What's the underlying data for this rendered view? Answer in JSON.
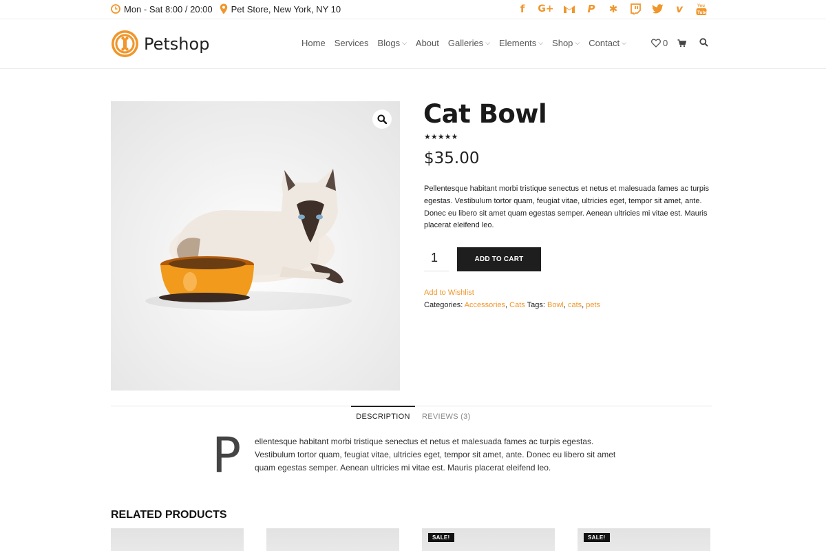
{
  "topbar": {
    "hours": "Mon - Sat 8:00 / 20:00",
    "location": "Pet Store, New York, NY 10",
    "social": [
      "facebook-icon",
      "google-plus-icon",
      "gmail-icon",
      "paypal-icon",
      "slack-icon",
      "twitch-icon",
      "twitter-icon",
      "vimeo-icon",
      "youtube-icon"
    ]
  },
  "header": {
    "brand": "Petshop",
    "nav": [
      {
        "label": "Home",
        "dropdown": false
      },
      {
        "label": "Services",
        "dropdown": false
      },
      {
        "label": "Blogs",
        "dropdown": true
      },
      {
        "label": "About",
        "dropdown": false
      },
      {
        "label": "Galleries",
        "dropdown": true
      },
      {
        "label": "Elements",
        "dropdown": true
      },
      {
        "label": "Shop",
        "dropdown": true
      },
      {
        "label": "Contact",
        "dropdown": true
      }
    ],
    "wishlist_count": "0"
  },
  "product": {
    "title": "Cat Bowl",
    "rating": 5,
    "stars": "★★★★★",
    "price": "$35.00",
    "short_description": "Pellentesque habitant morbi tristique senectus et netus et malesuada fames ac turpis egestas. Vestibulum tortor quam, feugiat vitae, ultricies eget, tempor sit amet, ante. Donec eu libero sit amet quam egestas semper. Aenean ultricies mi vitae est. Mauris placerat eleifend leo.",
    "quantity": "1",
    "add_to_cart": "ADD TO CART",
    "wishlist": "Add to Wishlist",
    "categories_label": "Categories:",
    "categories": [
      "Accessories",
      "Cats"
    ],
    "tags_label": "Tags:",
    "tags": [
      "Bowl",
      "cats",
      "pets"
    ]
  },
  "tabs": {
    "description": "DESCRIPTION",
    "reviews": "REVIEWS (3)"
  },
  "long_description": {
    "dropcap": "P",
    "text": "ellentesque habitant morbi tristique senectus et netus et malesuada fames ac turpis egestas. Vestibulum tortor quam, feugiat vitae, ultricies eget, tempor sit amet, ante. Donec eu libero sit amet quam egestas semper. Aenean ultricies mi vitae est. Mauris placerat eleifend leo."
  },
  "related": {
    "title": "RELATED PRODUCTS",
    "sale_label": "SALE!"
  },
  "colors": {
    "accent": "#f0962b",
    "dark": "#1e1e1e"
  }
}
